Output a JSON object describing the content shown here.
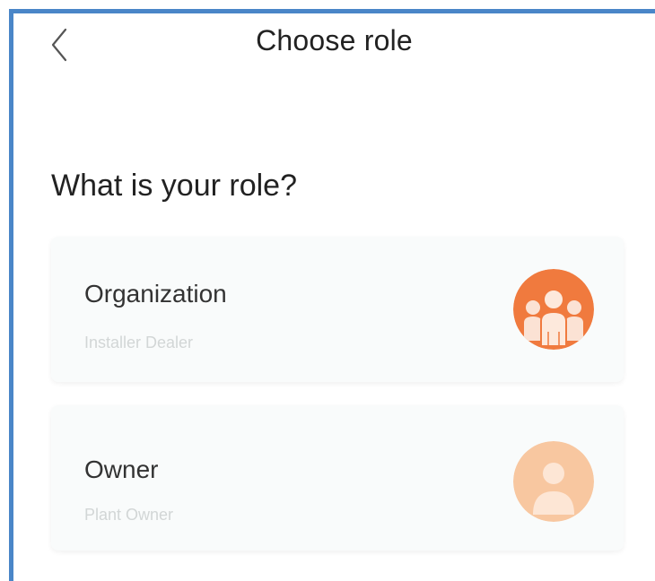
{
  "header": {
    "title": "Choose role",
    "back_icon": "chevron-left-icon"
  },
  "question": "What is your role?",
  "roles": [
    {
      "title": "Organization",
      "subtitle": "Installer Dealer",
      "icon": "group-avatar-icon",
      "icon_color": "#f07a3e"
    },
    {
      "title": "Owner",
      "subtitle": "Plant Owner",
      "icon": "person-avatar-icon",
      "icon_color": "#f8c7a0"
    }
  ],
  "colors": {
    "frame_border": "#4a86c8",
    "card_background": "#f9fbfb",
    "title_text": "#222222",
    "subtitle_text": "#d2d6d6"
  }
}
